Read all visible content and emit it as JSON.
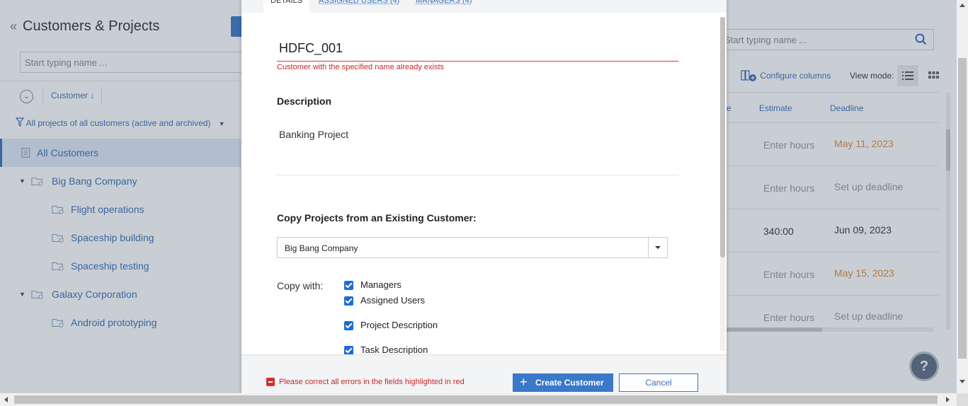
{
  "left_panel": {
    "title": "Customers & Projects",
    "back_glyph": "«",
    "search_placeholder": "Start typing name ...",
    "sort_label": "Customer ↓",
    "filter_label": "All projects of all customers (active and archived)",
    "tree": [
      {
        "label": "All Customers",
        "level": 0,
        "type": "all",
        "active": true
      },
      {
        "label": "Big Bang Company",
        "level": 0,
        "type": "customer",
        "expanded": true
      },
      {
        "label": "Flight operations",
        "level": 1,
        "type": "project"
      },
      {
        "label": "Spaceship building",
        "level": 1,
        "type": "project"
      },
      {
        "label": "Spaceship testing",
        "level": 1,
        "type": "project"
      },
      {
        "label": "Galaxy Corporation",
        "level": 0,
        "type": "customer",
        "expanded": true
      },
      {
        "label": "Android prototyping",
        "level": 1,
        "type": "project"
      }
    ]
  },
  "right_panel": {
    "search_placeholder": "Start typing name ...",
    "configure_columns": "Configure columns",
    "view_mode_label": "View mode:",
    "columns": [
      "e",
      "Estimate",
      "Deadline"
    ],
    "rows": [
      {
        "estimate": "Enter hours",
        "deadline": "May 11, 2023",
        "deadline_style": "orange"
      },
      {
        "estimate": "Enter hours",
        "deadline": "Set up deadline",
        "deadline_style": "muted"
      },
      {
        "estimate": "340:00",
        "deadline": "Jun 09, 2023",
        "deadline_style": "dark",
        "estimate_style": "val"
      },
      {
        "estimate": "Enter hours",
        "deadline": "May 15, 2023",
        "deadline_style": "orange"
      },
      {
        "estimate": "Enter hours",
        "deadline": "Set up deadline",
        "deadline_style": "muted"
      }
    ],
    "help_glyph": "?"
  },
  "modal": {
    "tabs": {
      "details": "DETAILS",
      "assigned_users": "ASSIGNED USERS (4)",
      "managers": "MANAGERS (4)"
    },
    "name_value": "HDFC_001",
    "name_error": "Customer with the specified name already exists",
    "description_heading": "Description",
    "description_value": "Banking Project",
    "copy_heading": "Copy Projects from an Existing Customer:",
    "copy_source": "Big Bang Company",
    "copy_with_label": "Copy with:",
    "copy_options": [
      {
        "label": "Managers",
        "checked": true
      },
      {
        "label": "Assigned Users",
        "checked": true
      },
      {
        "label": "Project Description",
        "checked": true
      },
      {
        "label": "Task Description",
        "checked": true
      }
    ],
    "footer_error": "Please correct all errors in the fields highlighted in red",
    "create_button": "Create Customer",
    "create_plus": "+",
    "cancel_button": "Cancel"
  },
  "colors": {
    "accent": "#3a78c9",
    "link": "#3a6fb5",
    "error": "#c62828",
    "deadline_orange": "#e08a3c"
  }
}
